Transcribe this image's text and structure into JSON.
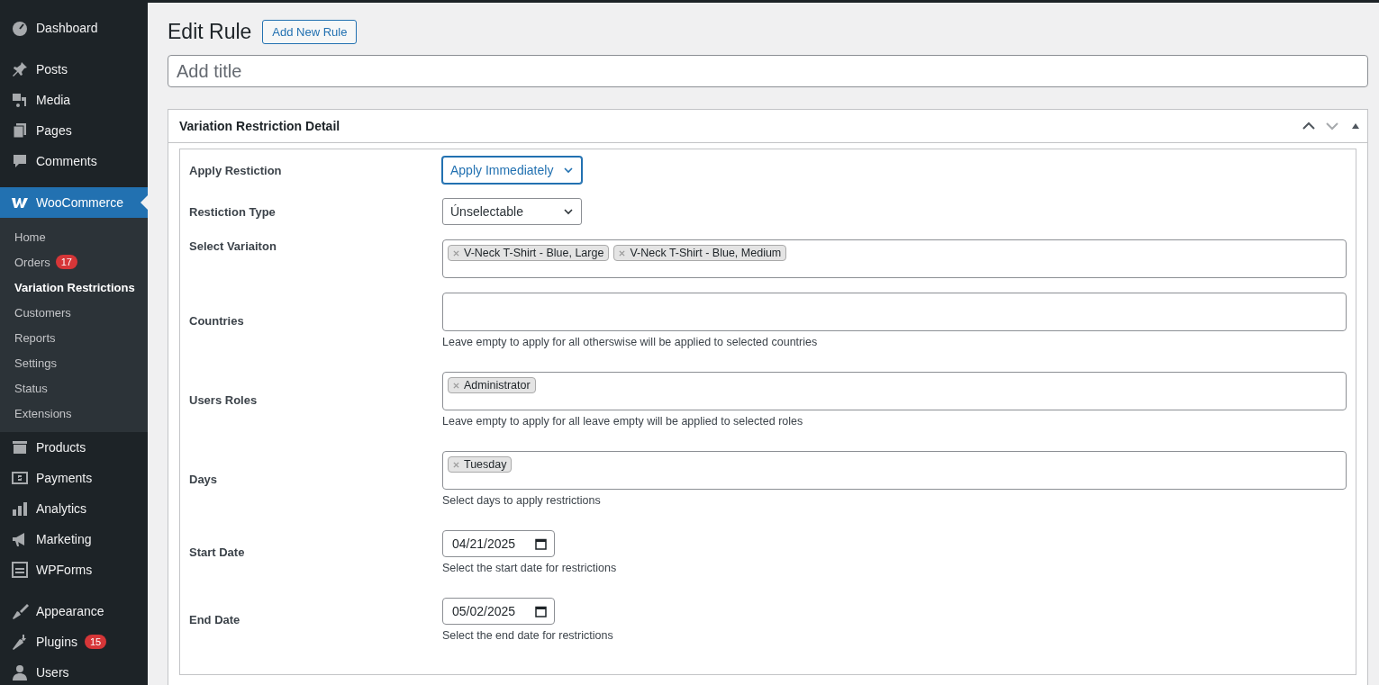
{
  "sidebar": {
    "groups": [
      [
        {
          "label": "Dashboard",
          "selected": false
        }
      ],
      [
        {
          "label": "Posts",
          "selected": false
        },
        {
          "label": "Media",
          "selected": false
        },
        {
          "label": "Pages",
          "selected": false
        },
        {
          "label": "Comments",
          "selected": false
        }
      ],
      [
        {
          "label": "WooCommerce",
          "selected": true,
          "children": [
            {
              "label": "Home",
              "selected": false
            },
            {
              "label": "Orders",
              "selected": false,
              "badge": "17"
            },
            {
              "label": "Variation Restrictions",
              "selected": true
            },
            {
              "label": "Customers",
              "selected": false
            },
            {
              "label": "Reports",
              "selected": false
            },
            {
              "label": "Settings",
              "selected": false
            },
            {
              "label": "Status",
              "selected": false
            },
            {
              "label": "Extensions",
              "selected": false
            }
          ]
        },
        {
          "label": "Products",
          "selected": false
        },
        {
          "label": "Payments",
          "selected": false
        },
        {
          "label": "Analytics",
          "selected": false
        },
        {
          "label": "Marketing",
          "selected": false
        },
        {
          "label": "WPForms",
          "selected": false
        }
      ],
      [
        {
          "label": "Appearance",
          "selected": false
        },
        {
          "label": "Plugins",
          "selected": false,
          "badge": "15"
        },
        {
          "label": "Users",
          "selected": false
        }
      ]
    ]
  },
  "page": {
    "heading": "Edit Rule",
    "add_button": "Add New Rule",
    "title_field": {
      "placeholder": "Add title"
    }
  },
  "metabox": {
    "title": "Variation Restriction Detail",
    "fields": [
      {
        "kind": "select",
        "label": "Apply Restiction",
        "value": "Apply Immediately",
        "focused": true
      },
      {
        "kind": "select",
        "label": "Restiction Type",
        "value": "Únselectable",
        "focused": false
      },
      {
        "kind": "tags",
        "label": "Select Variaiton",
        "tags": [
          "V-Neck T-Shirt - Blue, Large",
          "V-Neck T-Shirt - Blue, Medium"
        ]
      },
      {
        "kind": "tags",
        "label": "Countries",
        "help": "Leave empty to apply for all otherswise will be applied to selected countries"
      },
      {
        "kind": "tags",
        "label": "Users Roles",
        "tags": [
          "Administrator"
        ],
        "help": "Leave empty to apply for all leave empty will be applied to selected roles"
      },
      {
        "kind": "tags",
        "label": "Days",
        "tags": [
          "Tuesday"
        ],
        "help": "Select days to apply restrictions"
      },
      {
        "kind": "date",
        "label": "Start Date",
        "value": "04/21/2025",
        "help": "Select the start date for restrictions"
      },
      {
        "kind": "date",
        "label": "End Date",
        "value": "05/02/2025",
        "help": "Select the end date for restrictions"
      }
    ]
  }
}
